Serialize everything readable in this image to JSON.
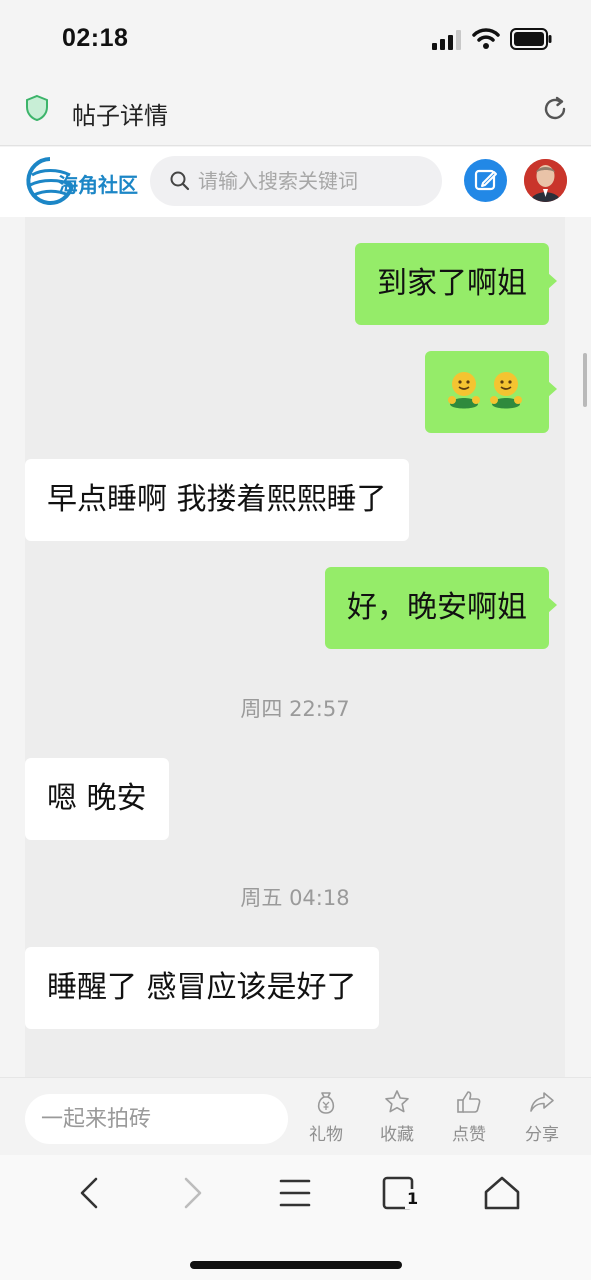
{
  "status_bar": {
    "time": "02:18"
  },
  "address_bar": {
    "title": "帖子详情"
  },
  "site_header": {
    "logo_text": "海角社区",
    "search_placeholder": "请输入搜索关键词"
  },
  "chat": {
    "messages": [
      {
        "side": "right",
        "text": "到家了啊姐"
      },
      {
        "side": "right",
        "emoji": [
          "hugging-face-emoji",
          "hugging-face-emoji"
        ]
      },
      {
        "side": "left",
        "text": "早点睡啊 我搂着熙熙睡了"
      },
      {
        "side": "right",
        "text": "好，晚安啊姐"
      },
      {
        "timestamp": "周四 22:57"
      },
      {
        "side": "left",
        "text": "嗯 晚安"
      },
      {
        "timestamp": "周五 04:18"
      },
      {
        "side": "left",
        "text": "睡醒了 感冒应该是好了"
      }
    ]
  },
  "comment_bar": {
    "placeholder": "一起来拍砖",
    "actions": [
      {
        "label": "礼物",
        "icon": "money-bag-icon"
      },
      {
        "label": "收藏",
        "icon": "star-icon"
      },
      {
        "label": "点赞",
        "icon": "thumbs-up-icon"
      },
      {
        "label": "分享",
        "icon": "share-icon"
      }
    ]
  },
  "nav_bar": {
    "icons": [
      "back-icon",
      "forward-icon",
      "menu-icon",
      "tabs-icon",
      "home-icon"
    ],
    "tab_count": "1"
  },
  "colors": {
    "sent_bubble": "#95ec69",
    "received_bubble": "#ffffff",
    "chat_background": "#ededed",
    "accent_blue": "#2288e6"
  }
}
